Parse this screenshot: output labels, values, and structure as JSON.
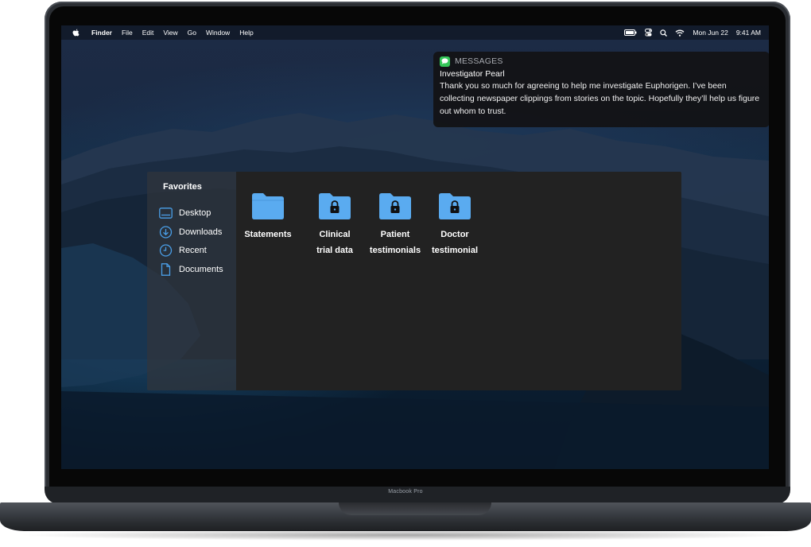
{
  "device": {
    "model_label": "Macbook Pro"
  },
  "menubar": {
    "app_name": "Finder",
    "menus": [
      "File",
      "Edit",
      "View",
      "Go",
      "Window",
      "Help"
    ],
    "date": "Mon Jun 22",
    "time": "9:41 AM",
    "icons": [
      "battery-icon",
      "control-center-icon",
      "search-icon",
      "wifi-icon"
    ]
  },
  "notification": {
    "app": "MESSAGES",
    "app_icon": "messages-icon",
    "app_icon_color": "#35c759",
    "sender": "Investigator Pearl",
    "message": "Thank you so much for agreeing to help me investigate Euphorigen. I’ve been collecting newspaper clippings from stories on the topic. Hopefully they’ll help us figure out whom to trust."
  },
  "finder": {
    "sidebar": {
      "title": "Favorites",
      "items": [
        {
          "label": "Desktop",
          "icon": "desktop-icon"
        },
        {
          "label": "Downloads",
          "icon": "downloads-icon"
        },
        {
          "label": "Recent",
          "icon": "clock-icon"
        },
        {
          "label": "Documents",
          "icon": "document-icon"
        }
      ]
    },
    "folders": [
      {
        "line1": "Statements",
        "line2": "",
        "locked": false
      },
      {
        "line1": "Clinical",
        "line2": "trial data",
        "locked": true
      },
      {
        "line1": "Patient",
        "line2": "testimonials",
        "locked": true
      },
      {
        "line1": "Doctor",
        "line2": "testimonial",
        "locked": true
      }
    ],
    "folder_color": "#5aabf0",
    "accent_color": "#4a9fe8"
  }
}
